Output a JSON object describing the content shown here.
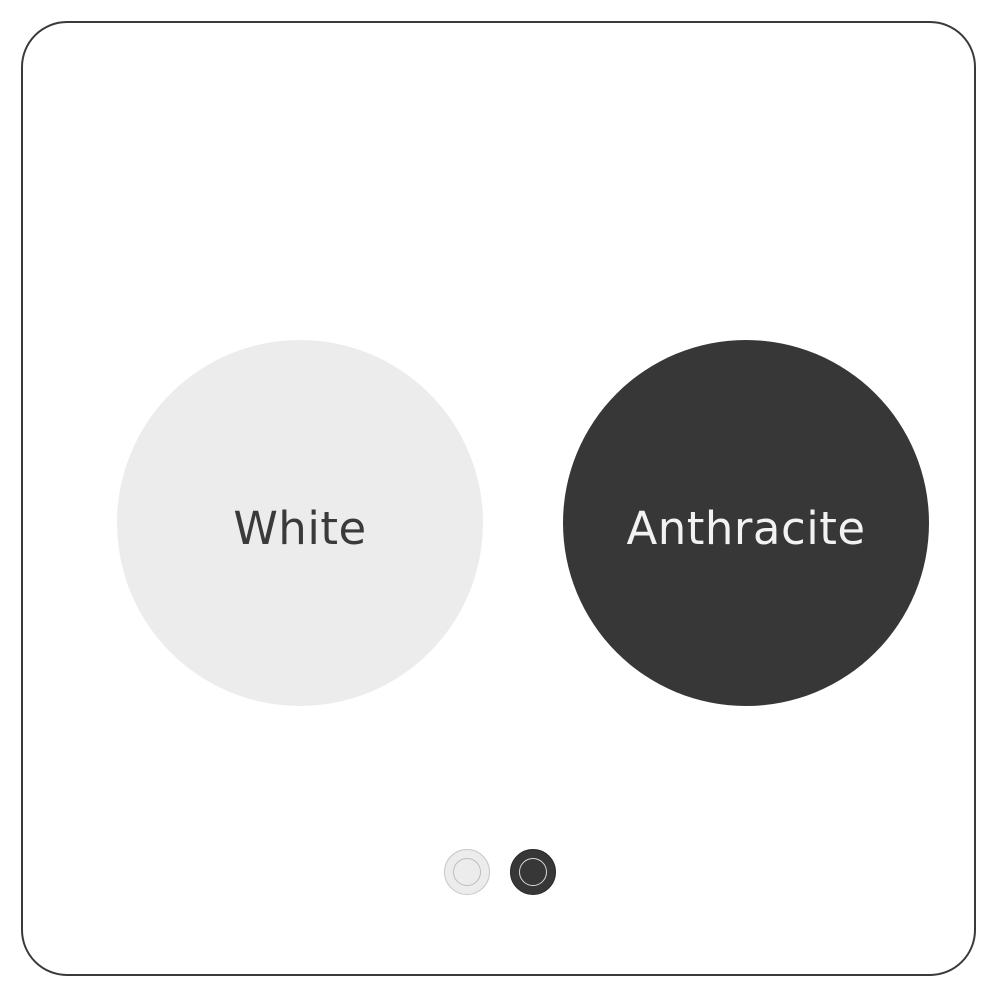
{
  "swatches": [
    {
      "label": "White",
      "color": "#ececec",
      "text_color": "#3a3a3a"
    },
    {
      "label": "Anthracite",
      "color": "#373737",
      "text_color": "#f2f2f2"
    }
  ],
  "selector": {
    "options": [
      {
        "name": "White",
        "color": "#ececec"
      },
      {
        "name": "Anthracite",
        "color": "#373737"
      }
    ]
  },
  "colors": {
    "border": "#3a3a3a",
    "background": "#ffffff"
  }
}
